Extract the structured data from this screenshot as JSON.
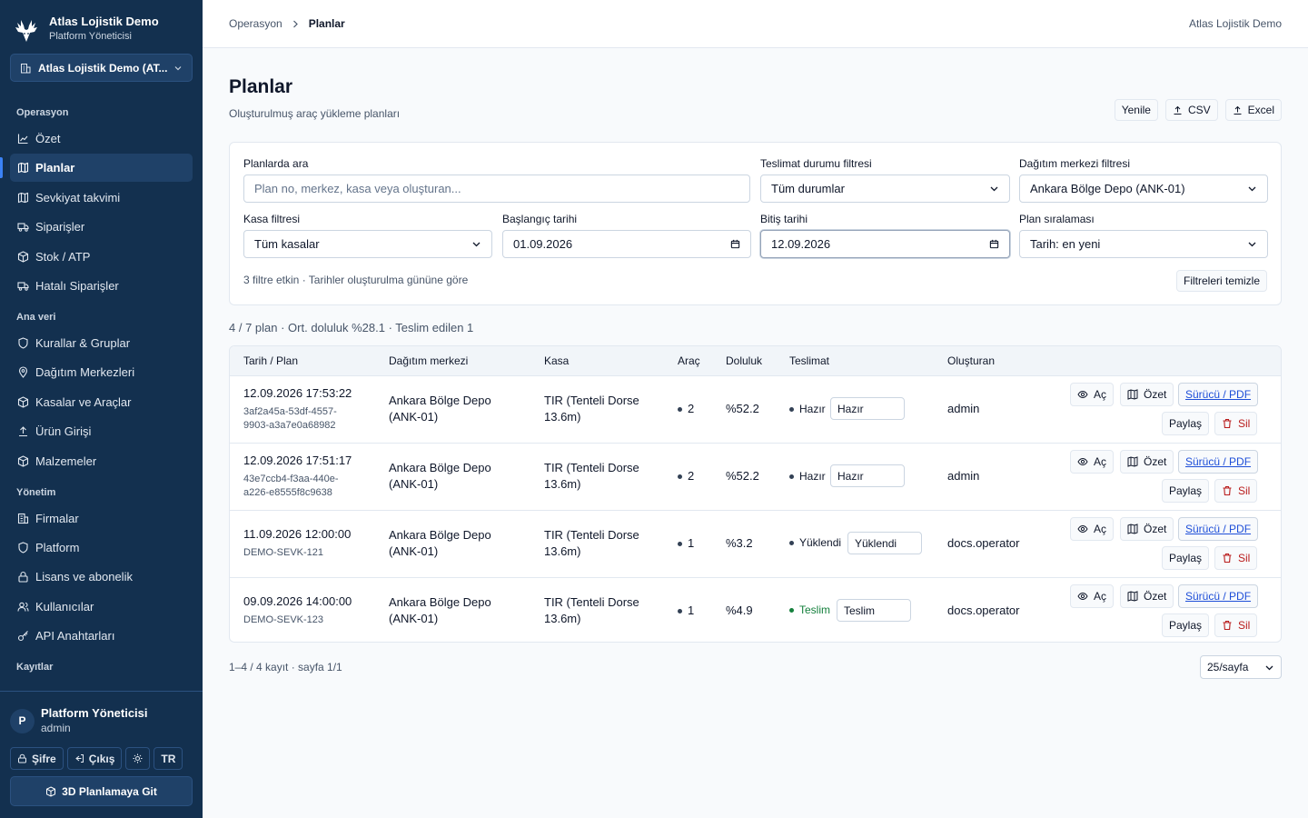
{
  "brand": {
    "title": "Atlas Lojistik Demo",
    "subtitle": "Platform Yöneticisi"
  },
  "company_select": {
    "value": "Atlas Lojistik Demo (AT..."
  },
  "nav": {
    "sections": [
      {
        "title": "Operasyon",
        "items": [
          "Özet",
          "Planlar",
          "Sevkiyat takvimi",
          "Siparişler",
          "Stok / ATP",
          "Hatalı Siparişler"
        ]
      },
      {
        "title": "Ana veri",
        "items": [
          "Kurallar & Gruplar",
          "Dağıtım Merkezleri",
          "Kasalar ve Araçlar",
          "Ürün Girişi",
          "Malzemeler"
        ]
      },
      {
        "title": "Yönetim",
        "items": [
          "Firmalar",
          "Platform",
          "Lisans ve abonelik",
          "Kullanıcılar",
          "API Anahtarları"
        ]
      },
      {
        "title": "Kayıtlar",
        "items": []
      }
    ],
    "active": "Planlar"
  },
  "user": {
    "initial": "P",
    "name": "Platform Yöneticisi",
    "role": "admin"
  },
  "footer": {
    "password": "Şifre",
    "logout": "Çıkış",
    "lang": "TR",
    "goto_3d": "3D Planlamaya Git"
  },
  "topbar": {
    "breadcrumb_parent": "Operasyon",
    "breadcrumb_current": "Planlar",
    "right_text": "Atlas Lojistik Demo"
  },
  "page": {
    "title": "Planlar",
    "subtitle": "Oluşturulmuş araç yükleme planları"
  },
  "actions": {
    "refresh": "Yenile",
    "csv": "CSV",
    "excel": "Excel"
  },
  "filters": {
    "search_label": "Planlarda ara",
    "search_placeholder": "Plan no, merkez, kasa veya oluşturan...",
    "delivery_label": "Teslimat durumu filtresi",
    "delivery_value": "Tüm durumlar",
    "center_label": "Dağıtım merkezi filtresi",
    "center_value": "Ankara Bölge Depo (ANK-01)",
    "crate_label": "Kasa filtresi",
    "crate_value": "Tüm kasalar",
    "start_label": "Başlangıç tarihi",
    "start_value": "01.09.2026",
    "end_label": "Bitiş tarihi",
    "end_value": "12.09.2026",
    "sort_label": "Plan sıralaması",
    "sort_value": "Tarih: en yeni",
    "meta": "3 filtre etkin · Tarihler oluşturulma gününe göre",
    "clear": "Filtreleri temizle"
  },
  "summary": "4 / 7 plan · Ort. doluluk %28.1 · Teslim edilen 1",
  "table": {
    "headers": [
      "Tarih / Plan",
      "Dağıtım merkezi",
      "Kasa",
      "Araç",
      "Doluluk",
      "Teslimat",
      "Oluşturan"
    ],
    "row_actions": {
      "open": "Aç",
      "summary": "Özet",
      "driver_pdf": "Sürücü / PDF",
      "share": "Paylaş",
      "delete": "Sil"
    },
    "rows": [
      {
        "date": "12.09.2026 17:53:22",
        "id1": "3af2a45a-53df-4557-",
        "id2": "9903-a3a7e0a68982",
        "center1": "Ankara Bölge Depo",
        "center2": "(ANK-01)",
        "crate1": "TIR (Tenteli Dorse",
        "crate2": "13.6m)",
        "vehicles": "2",
        "fill": "%52.2",
        "status": "Hazır",
        "status_select": "Hazır",
        "creator": "admin"
      },
      {
        "date": "12.09.2026 17:51:17",
        "id1": "43e7ccb4-f3aa-440e-",
        "id2": "a226-e8555f8c9638",
        "center1": "Ankara Bölge Depo",
        "center2": "(ANK-01)",
        "crate1": "TIR (Tenteli Dorse",
        "crate2": "13.6m)",
        "vehicles": "2",
        "fill": "%52.2",
        "status": "Hazır",
        "status_select": "Hazır",
        "creator": "admin"
      },
      {
        "date": "11.09.2026 12:00:00",
        "id1": "DEMO-SEVK-121",
        "id2": "",
        "center1": "Ankara Bölge Depo",
        "center2": "(ANK-01)",
        "crate1": "TIR (Tenteli Dorse",
        "crate2": "13.6m)",
        "vehicles": "1",
        "fill": "%3.2",
        "status": "Yüklendi",
        "status_select": "Yüklendi",
        "creator": "docs.operator"
      },
      {
        "date": "09.09.2026 14:00:00",
        "id1": "DEMO-SEVK-123",
        "id2": "",
        "center1": "Ankara Bölge Depo",
        "center2": "(ANK-01)",
        "crate1": "TIR (Tenteli Dorse",
        "crate2": "13.6m)",
        "vehicles": "1",
        "fill": "%4.9",
        "status": "Teslim",
        "status_select": "Teslim",
        "creator": "docs.operator"
      }
    ]
  },
  "pager": {
    "text": "1–4 / 4 kayıt · sayfa 1/1",
    "per_page": "25/sayfa"
  },
  "colors": {
    "sidebar": "#13304f",
    "sidebar_active": "#1f4168",
    "accent": "#3b82f6",
    "link": "#1d4ed8",
    "danger": "#b91c1c",
    "delivered": "#15803d"
  }
}
